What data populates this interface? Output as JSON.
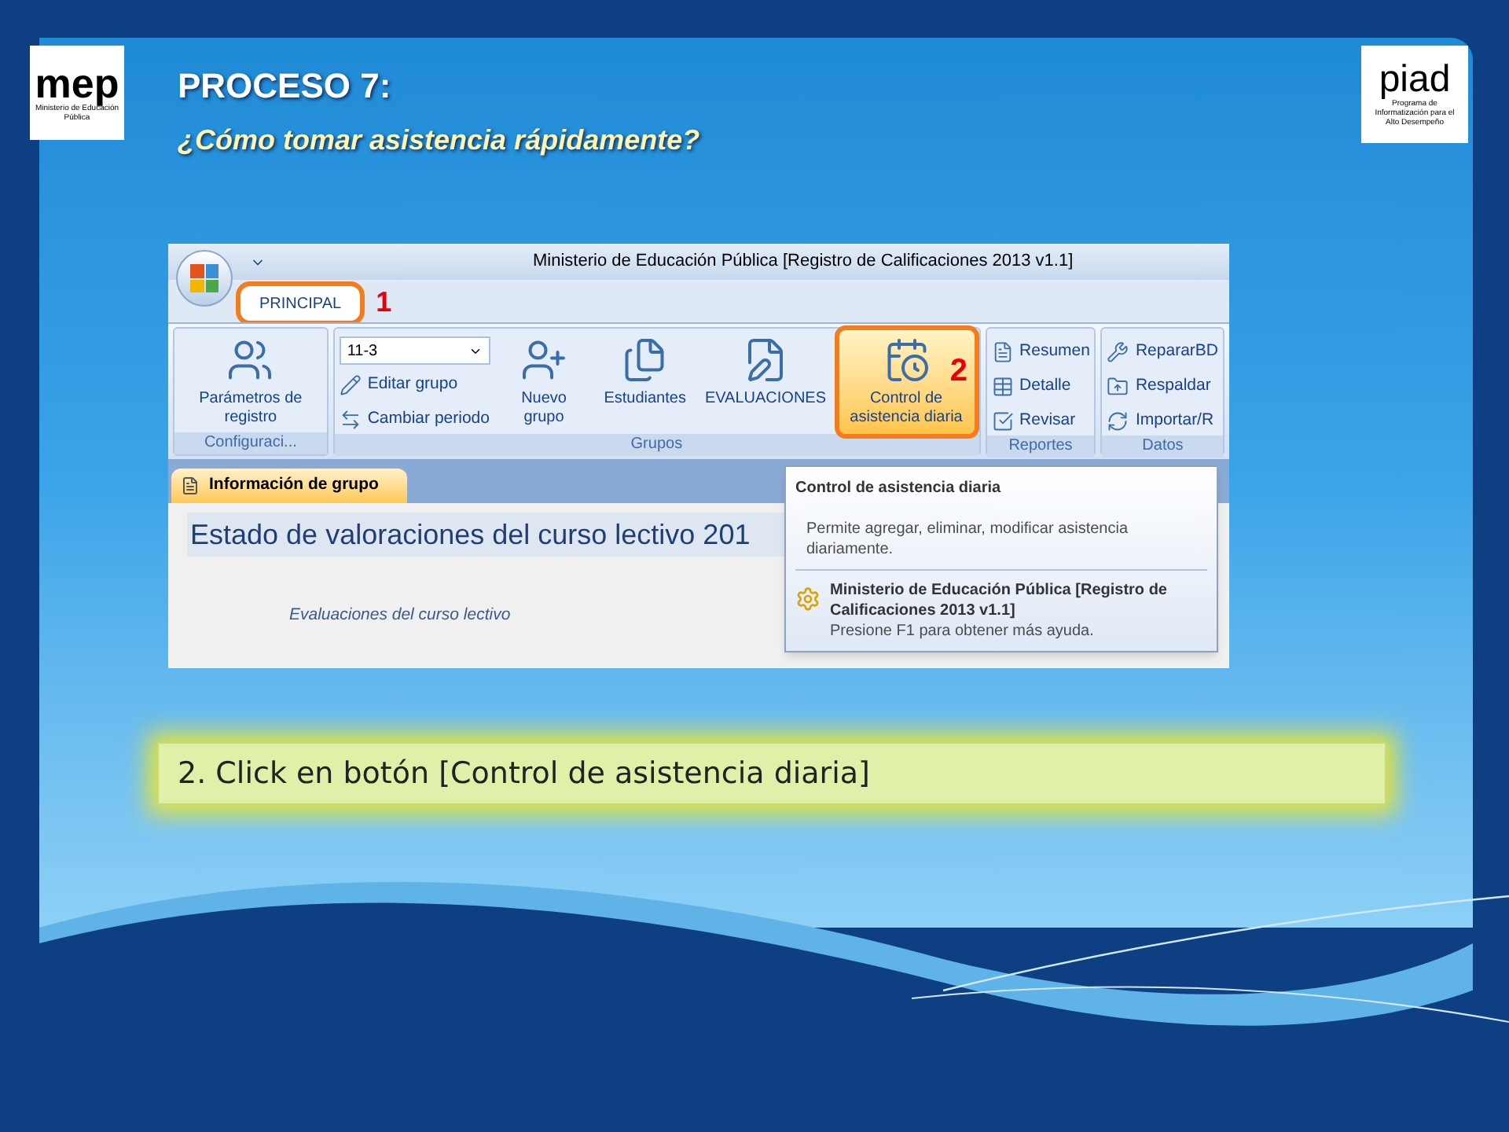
{
  "slide": {
    "title": "PROCESO 7:",
    "subtitle": "¿Cómo tomar asistencia rápidamente?",
    "logo_left": {
      "mark": "mep",
      "caption": "Ministerio de Educación Pública"
    },
    "logo_right": {
      "mark": "piad",
      "caption": "Programa de Informatización para el Alto Desempeño"
    },
    "caption": "2. Click en botón [Control de asistencia diaria]"
  },
  "app": {
    "window_title": "Ministerio de Educación Pública [Registro de Calificaciones 2013 v1.1]",
    "tabs": [
      {
        "label": "PRINCIPAL",
        "selected": true,
        "callout": "1"
      }
    ],
    "groups": [
      {
        "label": "Configuraci...",
        "items": [
          {
            "kind": "large",
            "label": "Parámetros de registro",
            "highlighted": false
          }
        ]
      },
      {
        "label": "Grupos",
        "items": [
          {
            "kind": "column",
            "items": [
              {
                "kind": "dropdown",
                "label": "11-3"
              },
              {
                "kind": "small",
                "label": "Editar grupo"
              },
              {
                "kind": "small",
                "label": "Cambiar periodo"
              }
            ]
          },
          {
            "kind": "large",
            "label": "Nuevo grupo",
            "highlighted": false
          },
          {
            "kind": "large",
            "label": "Estudiantes",
            "highlighted": false
          },
          {
            "kind": "large",
            "label": "EVALUACIONES",
            "highlighted": false
          },
          {
            "kind": "large",
            "label": "Control de asistencia diaria",
            "highlighted": true,
            "callout": "2"
          }
        ]
      },
      {
        "label": "Reportes",
        "items": [
          {
            "kind": "column",
            "items": [
              {
                "kind": "small",
                "label": "Resumen"
              },
              {
                "kind": "small",
                "label": "Detalle"
              },
              {
                "kind": "small",
                "label": "Revisar"
              }
            ]
          }
        ]
      },
      {
        "label": "Datos",
        "items": [
          {
            "kind": "column",
            "items": [
              {
                "kind": "small",
                "label": "RepararBD"
              },
              {
                "kind": "small",
                "label": "Respaldar"
              },
              {
                "kind": "small",
                "label": "Importar/R"
              }
            ]
          }
        ]
      }
    ],
    "doc_tab": "Información de grupo",
    "heading": "Estado de valoraciones del curso lectivo 201",
    "link": "Evaluaciones del curso lectivo",
    "tooltip": {
      "title": "Control de asistencia diaria",
      "body": "Permite agregar, eliminar, modificar asistencia diariamente.",
      "app_name": "Ministerio de Educación Pública [Registro de Calificaciones 2013 v1.1]",
      "help": "Presione F1 para obtener más ayuda."
    }
  }
}
